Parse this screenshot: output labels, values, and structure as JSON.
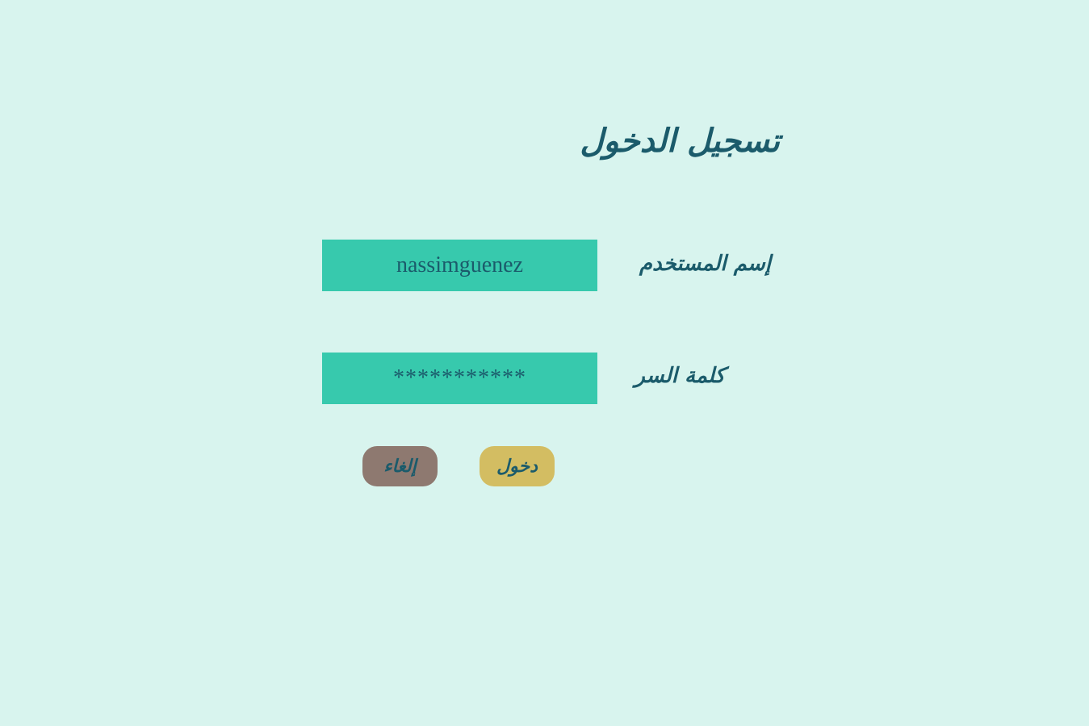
{
  "page": {
    "title": "تسجيل الدخول"
  },
  "form": {
    "username": {
      "label": "إسم المستخدم",
      "value": "nassimguenez"
    },
    "password": {
      "label": "كلمة السر",
      "value": "***********"
    }
  },
  "buttons": {
    "login_label": "دخول",
    "cancel_label": "إلغاء"
  },
  "colors": {
    "background": "#d8f4ee",
    "input_fill": "#37c9ad",
    "text": "#1b5b6b",
    "login_button": "#d3bd62",
    "cancel_button": "#8e7970"
  }
}
